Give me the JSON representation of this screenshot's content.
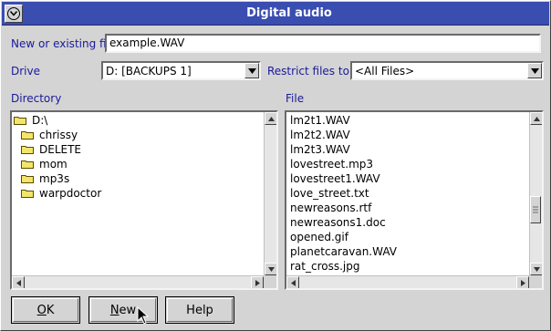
{
  "window": {
    "title": "Digital audio"
  },
  "labels": {
    "filename": "New or existing fil",
    "drive": "Drive",
    "restrict": "Restrict files to",
    "directory": "Directory",
    "file": "File"
  },
  "filename": {
    "value": "example.WAV"
  },
  "drive": {
    "value": "D:  [BACKUPS 1]"
  },
  "restrict": {
    "value": "<All Files>"
  },
  "directory": {
    "items": [
      {
        "label": "D:\\",
        "icon": "open-folder-icon"
      },
      {
        "label": "chrissy",
        "icon": "folder-icon"
      },
      {
        "label": "DELETE",
        "icon": "folder-icon"
      },
      {
        "label": "mom",
        "icon": "folder-icon"
      },
      {
        "label": "mp3s",
        "icon": "folder-icon"
      },
      {
        "label": "warpdoctor",
        "icon": "folder-icon"
      }
    ]
  },
  "files": {
    "items": [
      "lm2t1.WAV",
      "lm2t2.WAV",
      "lm2t3.WAV",
      "lovestreet.mp3",
      "lovestreet1.WAV",
      "love_street.txt",
      "newreasons.rtf",
      "newreasons1.doc",
      "opened.gif",
      "planetcaravan.WAV",
      "rat_cross.jpg"
    ]
  },
  "buttons": {
    "ok_rest": "K",
    "ok_mnemonic": "O",
    "new_rest": "ew",
    "new_mnemonic": "N",
    "help": "Help"
  },
  "colors": {
    "title_bar": "#3a4db0",
    "label": "#1a1a9a",
    "face": "#d4d4d4"
  }
}
